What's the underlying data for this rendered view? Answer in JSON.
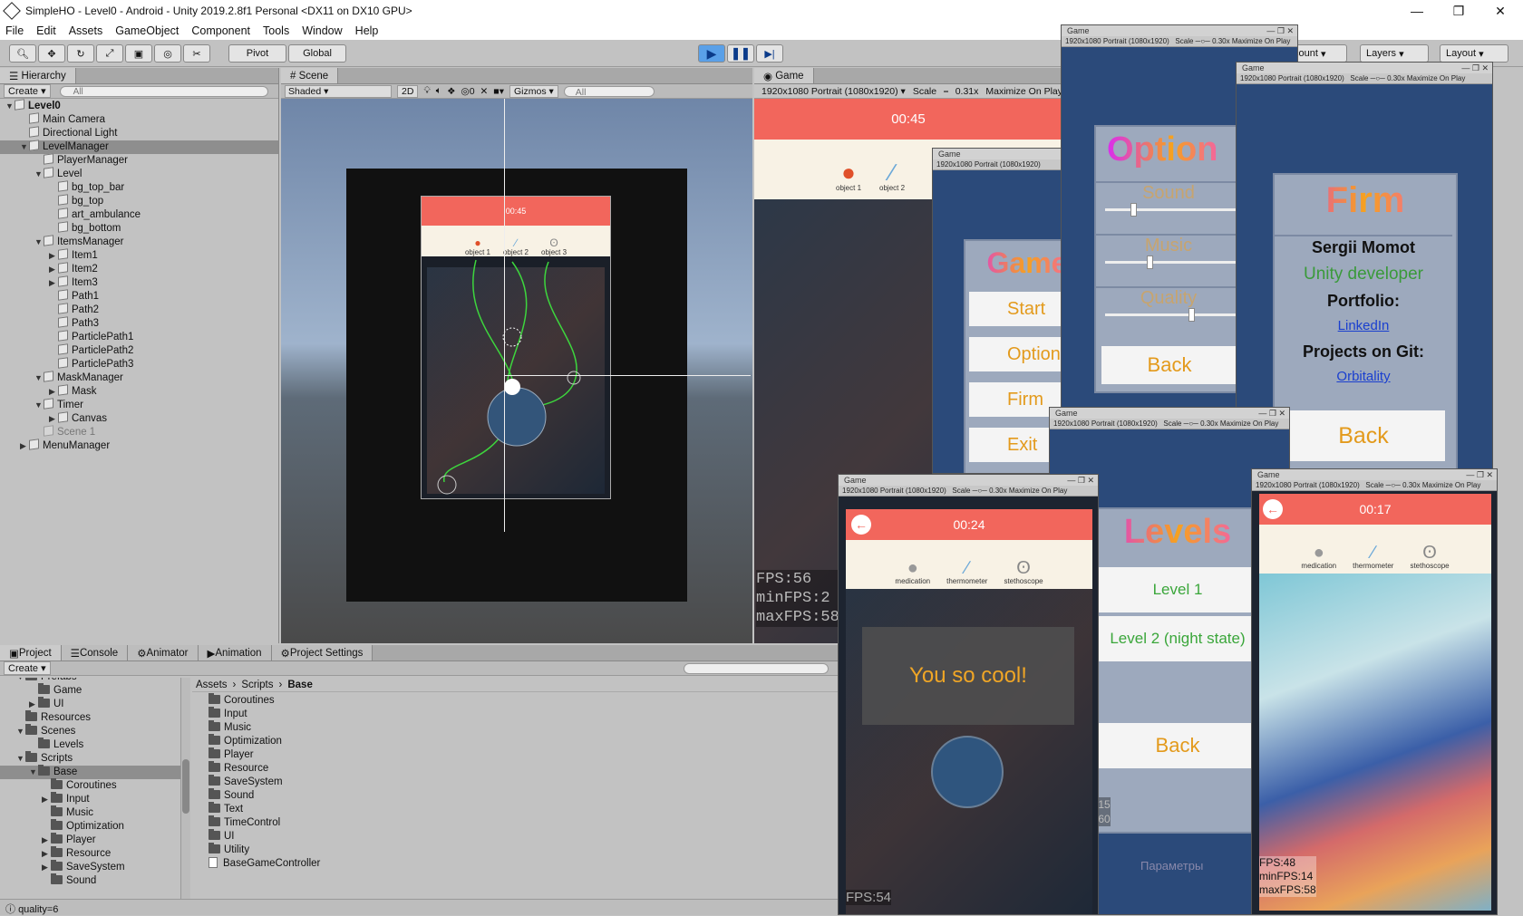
{
  "window": {
    "title": "SimpleHO - Level0 - Android - Unity 2019.2.8f1 Personal <DX11 on DX10 GPU>"
  },
  "menu": [
    "File",
    "Edit",
    "Assets",
    "GameObject",
    "Component",
    "Tools",
    "Window",
    "Help"
  ],
  "toolbar": {
    "pivot": "Pivot",
    "global": "Global",
    "account": "count",
    "layers": "Layers",
    "layout": "Layout"
  },
  "hierarchy": {
    "tab": "Hierarchy",
    "create": "Create",
    "search": "All",
    "rows": [
      {
        "label": "Level0",
        "indent": 0,
        "tri": "▼",
        "bold": true,
        "icon": "unity"
      },
      {
        "label": "Main Camera",
        "indent": 1,
        "tri": "",
        "icon": "cube"
      },
      {
        "label": "Directional Light",
        "indent": 1,
        "tri": "",
        "icon": "cube"
      },
      {
        "label": "LevelManager",
        "indent": 1,
        "tri": "▼",
        "icon": "cube",
        "sel": true
      },
      {
        "label": "PlayerManager",
        "indent": 2,
        "tri": "",
        "icon": "cube"
      },
      {
        "label": "Level",
        "indent": 2,
        "tri": "▼",
        "icon": "cube"
      },
      {
        "label": "bg_top_bar",
        "indent": 3,
        "tri": "",
        "icon": "cube"
      },
      {
        "label": "bg_top",
        "indent": 3,
        "tri": "",
        "icon": "cube"
      },
      {
        "label": "art_ambulance",
        "indent": 3,
        "tri": "",
        "icon": "cube"
      },
      {
        "label": "bg_bottom",
        "indent": 3,
        "tri": "",
        "icon": "cube"
      },
      {
        "label": "ItemsManager",
        "indent": 2,
        "tri": "▼",
        "icon": "cube"
      },
      {
        "label": "Item1",
        "indent": 3,
        "tri": "▶",
        "icon": "cube"
      },
      {
        "label": "Item2",
        "indent": 3,
        "tri": "▶",
        "icon": "cube"
      },
      {
        "label": "Item3",
        "indent": 3,
        "tri": "▶",
        "icon": "cube"
      },
      {
        "label": "Path1",
        "indent": 3,
        "tri": "",
        "icon": "cube"
      },
      {
        "label": "Path2",
        "indent": 3,
        "tri": "",
        "icon": "cube"
      },
      {
        "label": "Path3",
        "indent": 3,
        "tri": "",
        "icon": "cube"
      },
      {
        "label": "ParticlePath1",
        "indent": 3,
        "tri": "",
        "icon": "cube"
      },
      {
        "label": "ParticlePath2",
        "indent": 3,
        "tri": "",
        "icon": "cube"
      },
      {
        "label": "ParticlePath3",
        "indent": 3,
        "tri": "",
        "icon": "cube"
      },
      {
        "label": "MaskManager",
        "indent": 2,
        "tri": "▼",
        "icon": "cube"
      },
      {
        "label": "Mask",
        "indent": 3,
        "tri": "▶",
        "icon": "cube"
      },
      {
        "label": "Timer",
        "indent": 2,
        "tri": "▼",
        "icon": "cube"
      },
      {
        "label": "Canvas",
        "indent": 3,
        "tri": "▶",
        "icon": "cube"
      },
      {
        "label": "Scene 1",
        "indent": 2,
        "tri": "",
        "icon": "cube",
        "dim": true
      },
      {
        "label": "MenuManager",
        "indent": 1,
        "tri": "▶",
        "icon": "cube"
      }
    ]
  },
  "scene": {
    "tab": "Scene",
    "shading": "Shaded",
    "mode2d": "2D",
    "gizmos": "Gizmos",
    "search": "All",
    "timer": "00:45",
    "fx_count": "0",
    "items": [
      "object 1",
      "object 2",
      "object 3"
    ]
  },
  "game_main": {
    "tab": "Game",
    "resolution": "1920x1080 Portrait (1080x1920)",
    "scale_label": "Scale",
    "scale_value": "0.31x",
    "maximize": "Maximize On Play",
    "timer": "00:45",
    "items": [
      "object 1",
      "object 2"
    ],
    "fps": "FPS:56",
    "minfps": "minFPS:2",
    "maxfps": "maxFPS:58"
  },
  "game_menu": {
    "title": "Game",
    "res": "1920x1080 Portrait (1080x1920)",
    "scale": "Scale",
    "heading": "Game",
    "buttons": [
      "Start",
      "Options",
      "Firm",
      "Exit"
    ]
  },
  "game_options": {
    "title": "Game",
    "res": "1920x1080 Portrait (1080x1920)",
    "scale": "Scale",
    "scale_value": "0.30x",
    "maximize": "Maximize On Play",
    "heading": "Option",
    "sound": "Sound",
    "music": "Music",
    "quality": "Quality",
    "back": "Back"
  },
  "game_firm": {
    "title": "Game",
    "res": "1920x1080 Portrait (1080x1920)",
    "scale": "Scale",
    "scale_value": "0.30x",
    "maximize": "Maximize On Play",
    "heading": "Firm",
    "name": "Sergii Momot",
    "role": "Unity developer",
    "portfolio": "Portfolio:",
    "linkedin": "LinkedIn",
    "projects": "Projects on Git:",
    "orbitality": "Orbitality",
    "back": "Back"
  },
  "game_levels": {
    "title": "Game",
    "res": "1920x1080 Portrait (1080x1920)",
    "scale": "Scale",
    "scale_value": "0.30x",
    "maximize": "Maximize On Play",
    "heading": "Levels",
    "level1": "Level 1",
    "level2": "Level 2 (night state)",
    "back": "Back",
    "footer": "Параметры",
    "fps1": ":15",
    "fps2": ":60"
  },
  "game_win": {
    "title": "Game",
    "res": "1920x1080 Portrait (1080x1920)",
    "scale": "Scale",
    "scale_value": "0.30x",
    "maximize": "Maximize On Play",
    "timer": "00:24",
    "items": [
      "medication",
      "thermometer",
      "stethoscope"
    ],
    "message": "You so cool!",
    "fps": "FPS:54"
  },
  "game_play": {
    "title": "Game",
    "res": "1920x1080 Portrait (1080x1920)",
    "scale": "Scale",
    "scale_value": "0.30x",
    "maximize": "Maximize On Play",
    "timer": "00:17",
    "items": [
      "medication",
      "thermometer",
      "stethoscope"
    ],
    "fps": "FPS:48",
    "minfps": "minFPS:14",
    "maxfps": "maxFPS:58"
  },
  "project": {
    "tabs": [
      "Project",
      "Console",
      "Animator",
      "Animation",
      "Project Settings"
    ],
    "create": "Create",
    "tree": [
      {
        "label": "Prefabs",
        "indent": 1,
        "tri": "▼"
      },
      {
        "label": "Game",
        "indent": 2,
        "tri": ""
      },
      {
        "label": "UI",
        "indent": 2,
        "tri": "▶"
      },
      {
        "label": "Resources",
        "indent": 1,
        "tri": ""
      },
      {
        "label": "Scenes",
        "indent": 1,
        "tri": "▼"
      },
      {
        "label": "Levels",
        "indent": 2,
        "tri": ""
      },
      {
        "label": "Scripts",
        "indent": 1,
        "tri": "▼"
      },
      {
        "label": "Base",
        "indent": 2,
        "tri": "▼",
        "sel": true
      },
      {
        "label": "Coroutines",
        "indent": 3,
        "tri": ""
      },
      {
        "label": "Input",
        "indent": 3,
        "tri": "▶"
      },
      {
        "label": "Music",
        "indent": 3,
        "tri": ""
      },
      {
        "label": "Optimization",
        "indent": 3,
        "tri": ""
      },
      {
        "label": "Player",
        "indent": 3,
        "tri": "▶"
      },
      {
        "label": "Resource",
        "indent": 3,
        "tri": "▶"
      },
      {
        "label": "SaveSystem",
        "indent": 3,
        "tri": "▶"
      },
      {
        "label": "Sound",
        "indent": 3,
        "tri": ""
      }
    ],
    "breadcrumb": [
      "Assets",
      "Scripts",
      "Base"
    ],
    "files": [
      "Coroutines",
      "Input",
      "Music",
      "Optimization",
      "Player",
      "Resource",
      "SaveSystem",
      "Sound",
      "Text",
      "TimeControl",
      "UI",
      "Utility",
      "BaseGameController"
    ]
  },
  "status": {
    "text": "quality=6"
  }
}
